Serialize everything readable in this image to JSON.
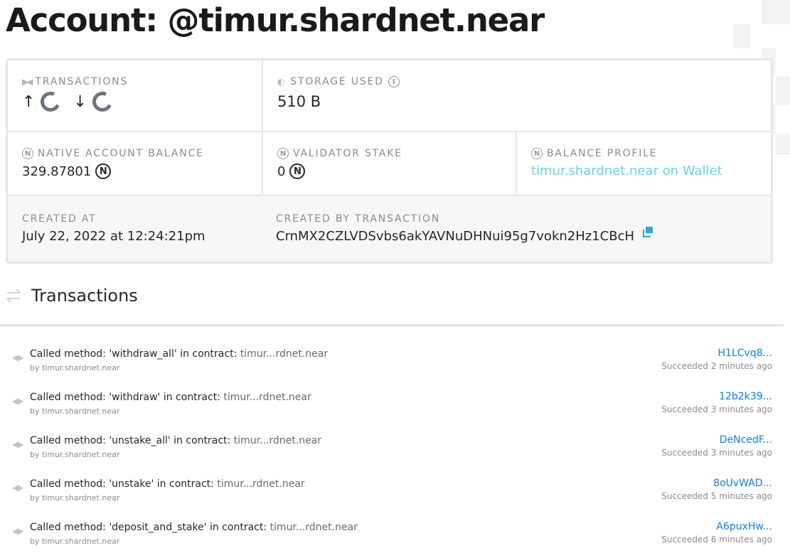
{
  "page": {
    "title": "Account: @timur.shardnet.near"
  },
  "summary": {
    "transactions_label": "TRANSACTIONS",
    "storage_label": "STORAGE USED",
    "storage_value": "510 B",
    "balance_label": "NATIVE ACCOUNT BALANCE",
    "balance_value": "329.87801",
    "stake_label": "VALIDATOR STAKE",
    "stake_value": "0",
    "profile_label": "BALANCE PROFILE",
    "profile_link": "timur.shardnet.near on Wallet",
    "created_at_label": "CREATED AT",
    "created_at_value": "July 22, 2022 at 12:24:21pm",
    "created_by_label": "CREATED BY TRANSACTION",
    "created_by_value": "CrnMX2CZLVDSvbs6akYAVNuDHNui95g7vokn2Hz1CBcH",
    "near_symbol": "N",
    "up_arrow": "↑",
    "down_arrow": "↓"
  },
  "transactions_section": {
    "title": "Transactions"
  },
  "transactions": [
    {
      "prefix": "Called method: 'withdraw_all' in contract: ",
      "contract": "timur...rdnet.near",
      "by": "by timur.shardnet.near",
      "hash": "H1LCvq8...",
      "status": "Succeeded 2 minutes ago"
    },
    {
      "prefix": "Called method: 'withdraw' in contract: ",
      "contract": "timur...rdnet.near",
      "by": "by timur.shardnet.near",
      "hash": "12b2k39...",
      "status": "Succeeded 3 minutes ago"
    },
    {
      "prefix": "Called method: 'unstake_all' in contract: ",
      "contract": "timur...rdnet.near",
      "by": "by timur.shardnet.near",
      "hash": "DeNcedF...",
      "status": "Succeeded 3 minutes ago"
    },
    {
      "prefix": "Called method: 'unstake' in contract: ",
      "contract": "timur...rdnet.near",
      "by": "by timur.shardnet.near",
      "hash": "8oUvWAD...",
      "status": "Succeeded 5 minutes ago"
    },
    {
      "prefix": "Called method: 'deposit_and_stake' in contract: ",
      "contract": "timur...rdnet.near",
      "by": "by timur.shardnet.near",
      "hash": "A6puxHw...",
      "status": "Succeeded 6 minutes ago"
    }
  ]
}
